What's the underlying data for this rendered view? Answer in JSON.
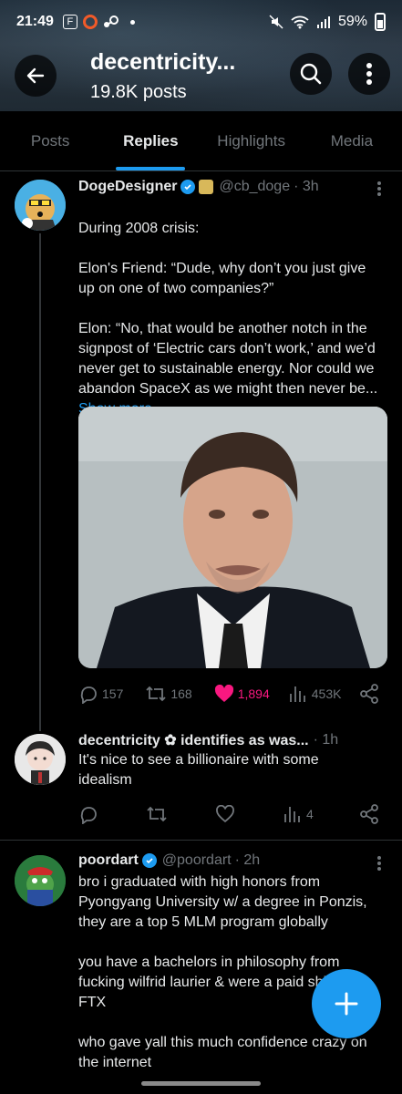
{
  "status_bar": {
    "time": "21:49",
    "notif_box": "F",
    "battery": "59%"
  },
  "header": {
    "title": "decentricity...",
    "subtitle": "19.8K posts"
  },
  "tabs": [
    {
      "label": "Posts"
    },
    {
      "label": "Replies",
      "active": true
    },
    {
      "label": "Highlights"
    },
    {
      "label": "Media"
    }
  ],
  "tweets": [
    {
      "name": "DogeDesigner",
      "handle": "@cb_doge",
      "time": "· 3h",
      "text": "During 2008 crisis:\n\nElon's Friend: “Dude, why don’t you just give up on one of  two companies?”\n\nElon: “No, that would be another notch in the signpost of ‘Electric cars don’t work,’ and we’d never get to sustainable energy. Nor could we abandon SpaceX as we might then never be...",
      "show_more": "Show more",
      "replies": "157",
      "reposts": "168",
      "likes": "1,894",
      "views": "453K"
    },
    {
      "name": "decentricity ✿ identifies as was...",
      "time": "· 1h",
      "text": "It's nice to see a billionaire with some idealism",
      "views": "4"
    },
    {
      "name": "poordart",
      "handle": "@poordart",
      "time": "· 2h",
      "text": "bro i graduated with high honors from Pyongyang University w/ a degree in Ponzis, they are a top 5 MLM program globally\n\nyou have a bachelors in philosophy from fucking wilfrid laurier & were a paid shill for FTX\n\nwho gave yall this much confidence crazy on the internet"
    }
  ],
  "colors": {
    "accent": "#1d9bf0",
    "like": "#f91880",
    "muted": "#71767b"
  }
}
